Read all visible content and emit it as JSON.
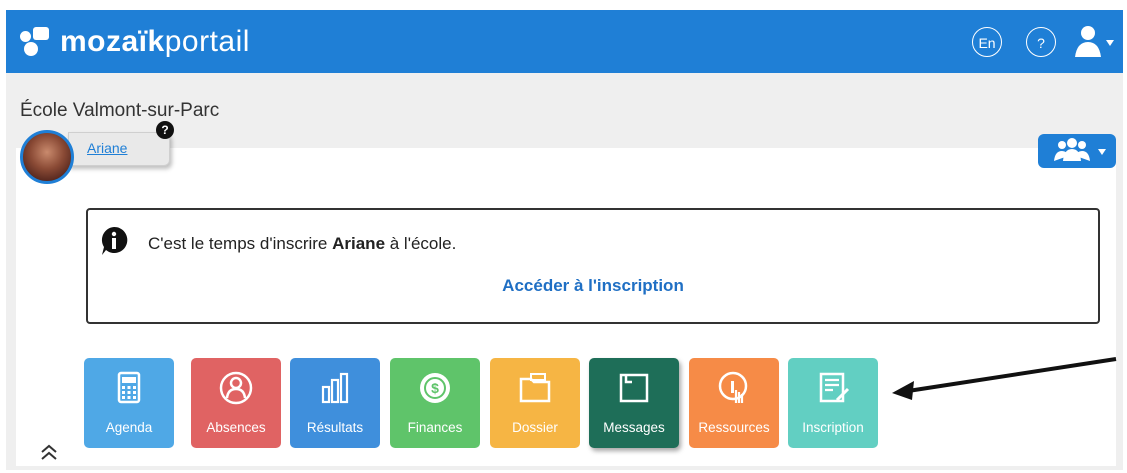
{
  "header": {
    "logo_bold": "mozaïk",
    "logo_light": "portail",
    "lang_button": "En",
    "help_button": "?",
    "brand_color": "#1f7fd6"
  },
  "school": {
    "name": "École Valmont-sur-Parc"
  },
  "student": {
    "name": "Ariane",
    "help_badge": "?"
  },
  "notice": {
    "text_before": "C'est le temps d'inscrire ",
    "student_name": "Ariane",
    "text_after": " à l'école.",
    "link": "Accéder à l'inscription"
  },
  "tiles": [
    {
      "label": "Agenda",
      "color": "#4fa8e6",
      "icon": "calendar-icon"
    },
    {
      "label": "Absences",
      "color": "#e06363",
      "icon": "person-icon"
    },
    {
      "label": "Résultats",
      "color": "#3f8fdc",
      "icon": "bar-chart-icon"
    },
    {
      "label": "Finances",
      "color": "#5fc46a",
      "icon": "dollar-coin-icon"
    },
    {
      "label": "Dossier",
      "color": "#f6b544",
      "icon": "folder-icon"
    },
    {
      "label": "Messages",
      "color": "#1e6e58",
      "icon": "message-icon"
    },
    {
      "label": "Ressources",
      "color": "#f68b47",
      "icon": "resource-hand-icon"
    },
    {
      "label": "Inscription",
      "color": "#62cfc2",
      "icon": "registration-form-icon"
    }
  ]
}
